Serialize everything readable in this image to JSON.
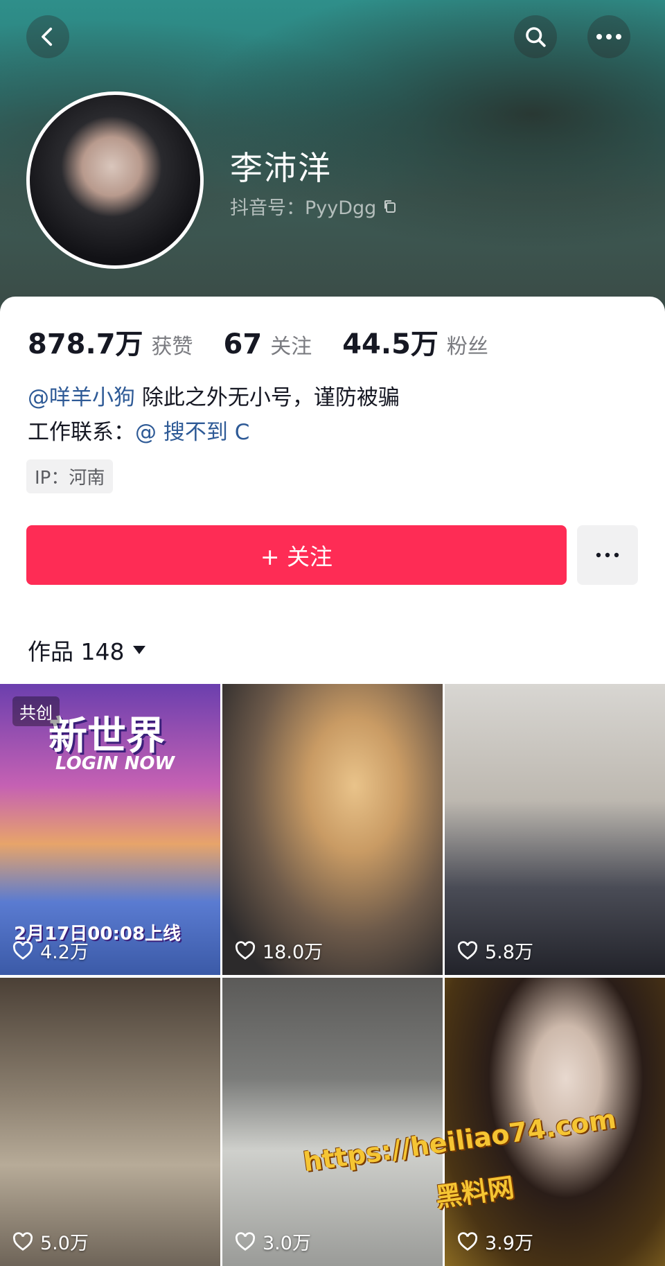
{
  "header": {
    "back_icon": "chevron-left-icon",
    "search_icon": "search-icon",
    "more_icon": "ellipsis-icon"
  },
  "profile": {
    "name": "李沛洋",
    "douyin_id": "抖音号：PyyDgg",
    "copy_icon": "copy-icon"
  },
  "stats": [
    {
      "value": "878.7万",
      "label": "获赞"
    },
    {
      "value": "67",
      "label": "关注"
    },
    {
      "value": "44.5万",
      "label": "粉丝"
    }
  ],
  "bio": {
    "line1_mention": "@咩羊小狗",
    "line1_text": " 除此之外无小号，谨防被骗",
    "line2_text": "工作联系：",
    "line2_mention": "@ 搜不到 C"
  },
  "ip_label": "IP：河南",
  "actions": {
    "follow_label": "+ 关注",
    "more_icon": "ellipsis-icon"
  },
  "works": {
    "label": "作品 148",
    "dropdown_icon": "caret-down-icon"
  },
  "videos": [
    {
      "likes": "4.2万",
      "badge": "共创",
      "poster_text": "新世界",
      "poster_sub": "LOGIN NOW",
      "poster_caption": "2月17日00:08上线"
    },
    {
      "likes": "18.0万"
    },
    {
      "likes": "5.8万"
    },
    {
      "likes": "5.0万"
    },
    {
      "likes": "3.0万"
    },
    {
      "likes": "3.9万"
    }
  ],
  "watermark": {
    "line1": "https://heiliao74.com",
    "line2": "黑料网"
  },
  "colors": {
    "accent": "#fe2c55",
    "link": "#2e5a96"
  }
}
